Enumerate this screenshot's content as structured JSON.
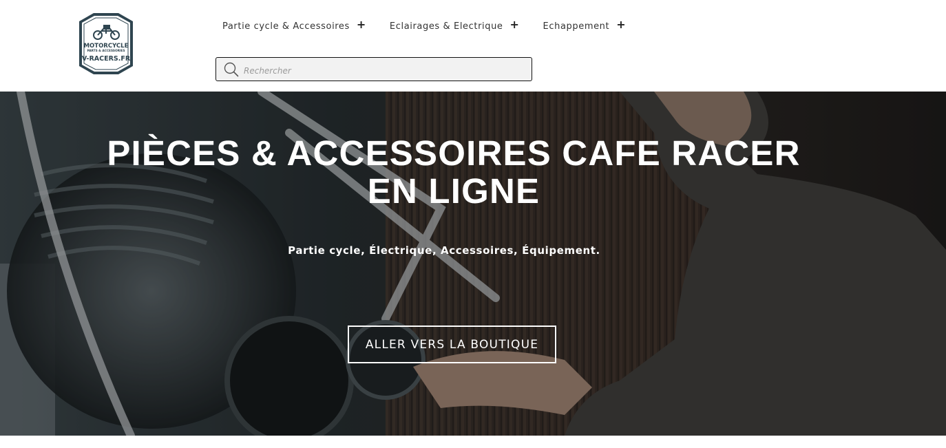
{
  "brand": {
    "logo_line1": "MOTORCYCLE",
    "logo_line2": "PARTS & ACCESSORIES",
    "logo_line3": "V-RACERS.FR",
    "logo_color": "#2f4550"
  },
  "nav": {
    "items": [
      {
        "label": "Partie cycle & Accessoires",
        "icon": "plus-icon"
      },
      {
        "label": "Eclairages & Electrique",
        "icon": "plus-icon"
      },
      {
        "label": "Echappement",
        "icon": "plus-icon"
      }
    ],
    "expand_symbol": "+"
  },
  "search": {
    "placeholder": "Rechercher",
    "value": "",
    "icon": "search-icon"
  },
  "hero": {
    "title_line1": "PIÈCES & ACCESSOIRES CAFE RACER",
    "title_line2": "EN LIGNE",
    "subtitle": "Partie cycle, Électrique, Accessoires, Équipement.",
    "cta_label": "ALLER VERS LA BOUTIQUE",
    "overlay_color": "#1e2426"
  }
}
